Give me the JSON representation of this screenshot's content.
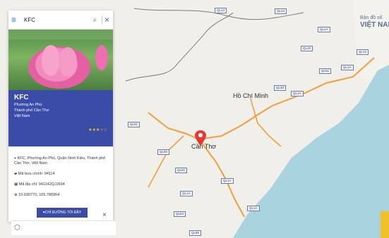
{
  "search": {
    "value": "KFC"
  },
  "place": {
    "name": "KFC",
    "line1": "Phường An Phú",
    "line2": "Thành phố Cần Thơ",
    "line3": "Việt Nam",
    "stars": "★★★☆☆"
  },
  "details": {
    "address": "KFC, Phường An Phú, Quận Ninh Kiều, Thành phố Cần Thơ, Việt Nam",
    "postal": "Mã bưu chính: 94114",
    "code": "Mã địa chỉ: 941142QJJ694",
    "coords": "10.030770, 105.780954"
  },
  "actions": {
    "directions": "♥CHỈ ĐƯỜNG TỚI ĐÂY"
  },
  "map": {
    "country_a": "Bản đồ số",
    "country_b": "VIỆT NAM",
    "hcm": "Hồ Chí Minh",
    "cantho": "Cần Thơ",
    "roads": [
      "QL14",
      "QL14",
      "QL20",
      "QL1A",
      "QL13",
      "QL51",
      "QL1A",
      "QL30",
      "QL1A",
      "QL91",
      "QL50",
      "QL61",
      "QL1A",
      "QL1A",
      "QL80",
      "QL63",
      "QL1A"
    ]
  }
}
